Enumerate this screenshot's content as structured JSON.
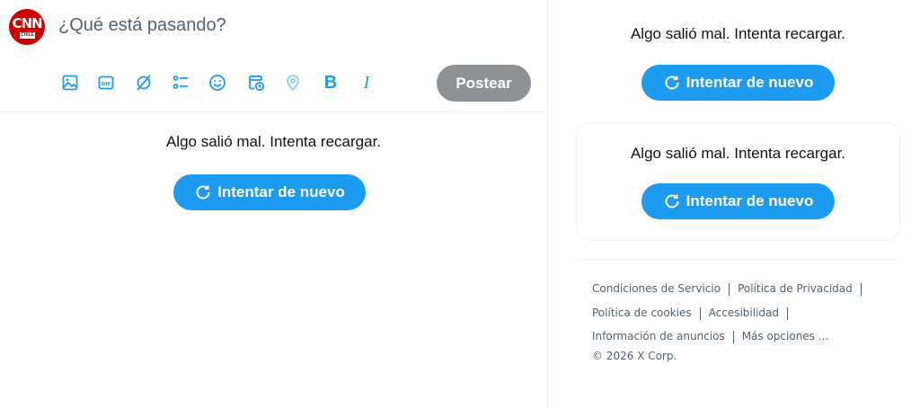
{
  "composer": {
    "avatar_text": "CNN",
    "avatar_sub": "CHILE",
    "placeholder": "¿Qué está pasando?",
    "post_label": "Postear",
    "tools": [
      "image-icon",
      "gif-icon",
      "grok-icon",
      "poll-icon",
      "emoji-icon",
      "schedule-icon",
      "location-icon",
      "bold-icon",
      "italic-icon"
    ],
    "bold_glyph": "B",
    "italic_glyph": "I"
  },
  "main_error": {
    "message": "Algo salió mal. Intenta recargar.",
    "retry_label": "Intentar de nuevo"
  },
  "sidebar": {
    "error1": {
      "message": "Algo salió mal. Intenta recargar.",
      "retry_label": "Intentar de nuevo"
    },
    "error2": {
      "message": "Algo salió mal. Intenta recargar.",
      "retry_label": "Intentar de nuevo"
    }
  },
  "footer": {
    "links": [
      "Condiciones de Servicio",
      "Política de Privacidad",
      "Política de cookies",
      "Accesibilidad",
      "Información de anuncios",
      "Más opciones ..."
    ],
    "copyright": "© 2026 X Corp."
  },
  "colors": {
    "accent": "#1d9bf0",
    "post_disabled": "#8e9295",
    "text": "#0f1419",
    "muted": "#536471"
  }
}
